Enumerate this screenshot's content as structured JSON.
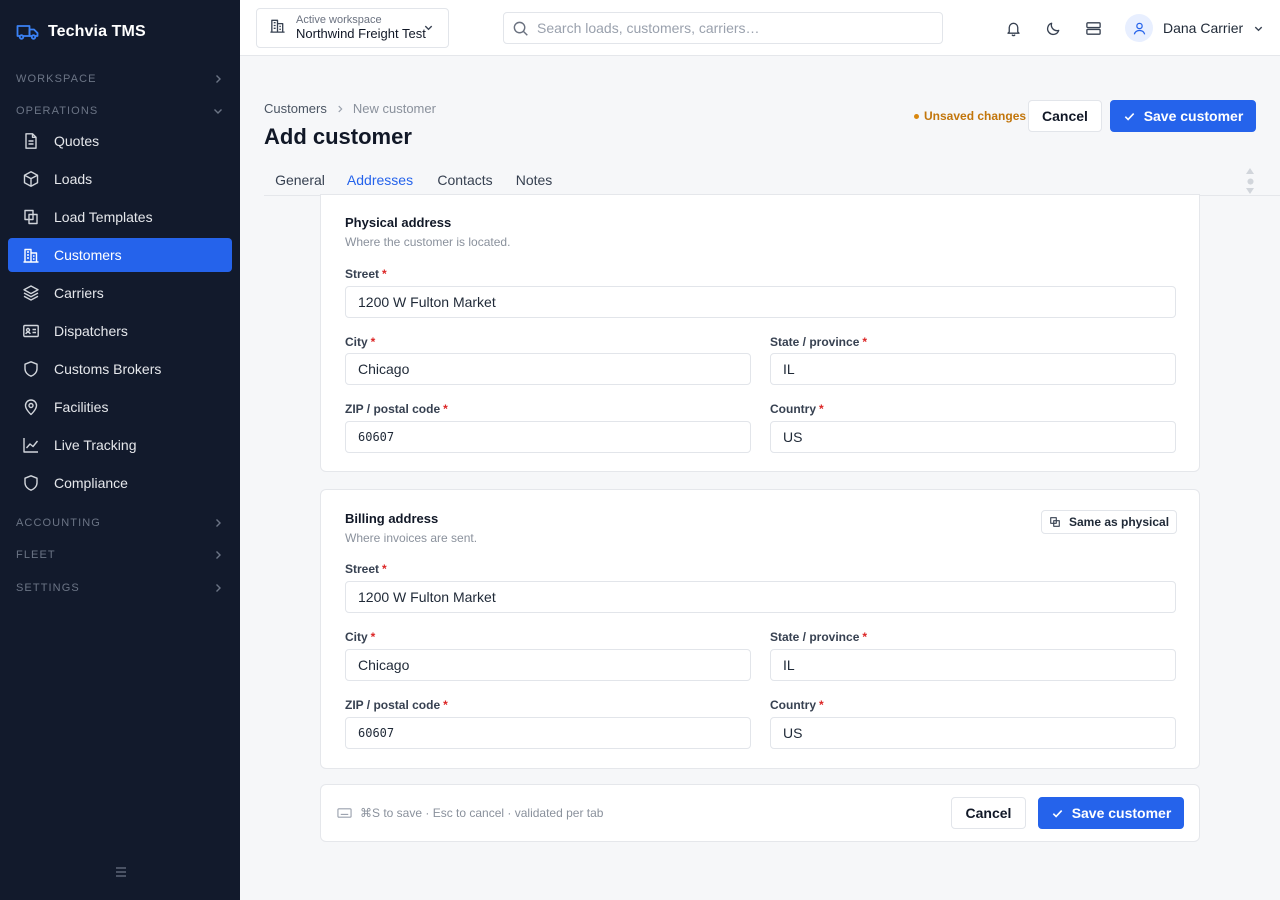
{
  "app": {
    "brand": "Techvia TMS"
  },
  "sidebar": {
    "sections": {
      "workspace": "WORKSPACE",
      "operations": "OPERATIONS",
      "accounting": "ACCOUNTING",
      "fleet": "FLEET",
      "settings": "SETTINGS"
    },
    "items": [
      {
        "label": "Quotes",
        "icon": "document-icon"
      },
      {
        "label": "Loads",
        "icon": "box-icon"
      },
      {
        "label": "Load Templates",
        "icon": "copy-icon"
      },
      {
        "label": "Customers",
        "icon": "building-icon",
        "active": true
      },
      {
        "label": "Carriers",
        "icon": "layers-icon"
      },
      {
        "label": "Dispatchers",
        "icon": "id-card-icon"
      },
      {
        "label": "Customs Brokers",
        "icon": "shield-icon"
      },
      {
        "label": "Facilities",
        "icon": "map-pin-icon"
      },
      {
        "label": "Live Tracking",
        "icon": "line-chart-icon"
      },
      {
        "label": "Compliance",
        "icon": "shield-icon"
      }
    ]
  },
  "topbar": {
    "workspace_label": "Active workspace",
    "workspace_name": "Northwind Freight Test",
    "search_placeholder": "Search loads, customers, carriers…",
    "user_name": "Dana Carrier"
  },
  "header": {
    "breadcrumb": [
      "Customers",
      "New customer"
    ],
    "title": "Add customer",
    "unsaved": "Unsaved changes",
    "cancel": "Cancel",
    "save": "Save customer"
  },
  "tabs": [
    {
      "label": "General"
    },
    {
      "label": "Addresses",
      "active": true
    },
    {
      "label": "Contacts"
    },
    {
      "label": "Notes"
    }
  ],
  "physical": {
    "title": "Physical address",
    "subtitle": "Where the customer is located.",
    "street_label": "Street",
    "street": "1200 W Fulton Market",
    "city_label": "City",
    "city": "Chicago",
    "state_label": "State / province",
    "state": "IL",
    "zip_label": "ZIP / postal code",
    "zip": "60607",
    "country_label": "Country",
    "country": "US"
  },
  "billing": {
    "title": "Billing address",
    "subtitle": "Where invoices are sent.",
    "same_as": "Same as physical",
    "street_label": "Street",
    "street": "1200 W Fulton Market",
    "city_label": "City",
    "city": "Chicago",
    "state_label": "State / province",
    "state": "IL",
    "zip_label": "ZIP / postal code",
    "zip": "60607",
    "country_label": "Country",
    "country": "US"
  },
  "footer": {
    "hint": "⌘S to save · Esc to cancel · validated per tab",
    "cancel": "Cancel",
    "save": "Save customer"
  },
  "colors": {
    "sidebar_bg": "#121a2c",
    "accent": "#2563eb",
    "warning": "#c2760c",
    "required": "#dc2626"
  }
}
